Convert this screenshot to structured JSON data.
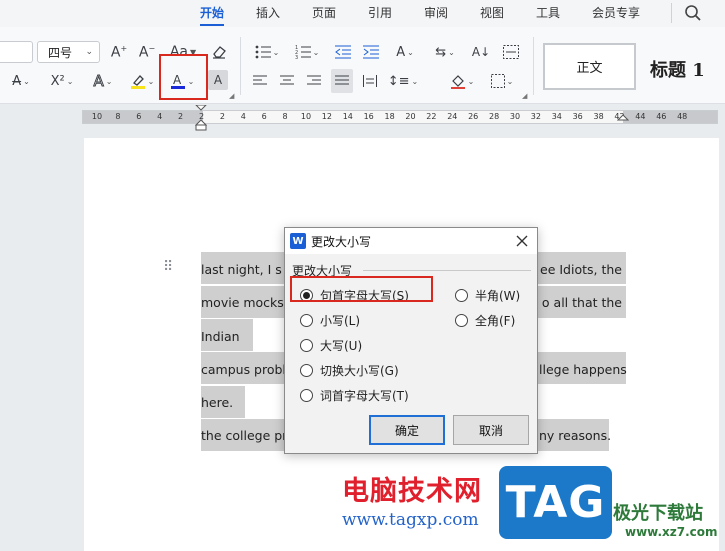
{
  "menu": {
    "tabs": [
      {
        "label": "开始",
        "active": true
      },
      {
        "label": "插入"
      },
      {
        "label": "页面"
      },
      {
        "label": "引用"
      },
      {
        "label": "审阅"
      },
      {
        "label": "视图"
      },
      {
        "label": "工具"
      },
      {
        "label": "会员专享"
      }
    ],
    "search_icon": "search-icon"
  },
  "ribbon": {
    "font_size": "四号",
    "change_case_label": "Aa",
    "superscript_label": "X²",
    "style_normal": "正文",
    "style_heading1": "标题 1",
    "colors": {
      "highlight": "#f7e21b",
      "font_color": "#1a2ad8",
      "accent": "#1a5fd6",
      "annotation_red": "#d9281e"
    }
  },
  "ruler": {
    "ticks": [
      "10",
      "8",
      "6",
      "4",
      "2",
      "2",
      "2",
      "4",
      "6",
      "8",
      "10",
      "12",
      "14",
      "16",
      "18",
      "20",
      "22",
      "24",
      "26",
      "28",
      "30",
      "32",
      "34",
      "36",
      "38",
      "42",
      "44",
      "46",
      "48"
    ]
  },
  "document": {
    "lines_left": [
      "last night, I s",
      "movie mocks",
      "Indian",
      "campus probl",
      "here.",
      "the college pr"
    ],
    "lines_right": [
      "ee Idiots, the",
      "o all that the",
      "",
      "llege happens",
      "",
      "ny reasons."
    ]
  },
  "dialog": {
    "title": "更改大小写",
    "group_label": "更改大小写",
    "options_left": [
      {
        "label": "句首字母大写(S)",
        "checked": true
      },
      {
        "label": "小写(L)",
        "checked": false
      },
      {
        "label": "大写(U)",
        "checked": false
      },
      {
        "label": "切换大小写(G)",
        "checked": false
      },
      {
        "label": "词首字母大写(T)",
        "checked": false
      }
    ],
    "options_right": [
      {
        "label": "半角(W)",
        "checked": false
      },
      {
        "label": "全角(F)",
        "checked": false
      }
    ],
    "ok_label": "确定",
    "cancel_label": "取消"
  },
  "watermark": {
    "brand_cn": "电脑技术网",
    "url": "www.tagxp.com",
    "tag": "TAG",
    "side_cn": "极光下载站",
    "side_url": "www.xz7.com"
  }
}
